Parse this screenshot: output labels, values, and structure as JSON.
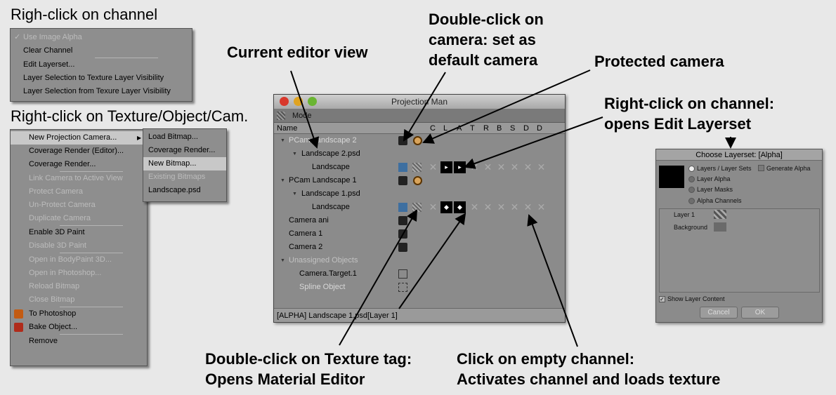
{
  "captions": {
    "right_click_channel": "Righ-click on channel",
    "right_click_texture": "Right-click on Texture/Object/Cam."
  },
  "callouts": {
    "current_editor_view": "Current editor view",
    "double_click_camera": [
      "Double-click on",
      "camera: set as",
      "default camera"
    ],
    "protected_camera": "Protected camera",
    "right_click_edit_layerset": [
      "Right-click on channel:",
      "opens Edit Layerset"
    ],
    "double_click_texture": [
      "Double-click on Texture tag:",
      "Opens Material Editor"
    ],
    "click_empty_channel": [
      "Click on empty channel:",
      "Activates channel and loads texture"
    ]
  },
  "channel_menu": {
    "items": [
      {
        "label": "Use Image Alpha",
        "disabled": true,
        "checked": true
      },
      {
        "label": "Clear Channel",
        "disabled": false
      },
      {
        "label": "Edit Layerset...",
        "disabled": false
      },
      {
        "label": "Layer Selection to Texture Layer Visibility",
        "disabled": false
      },
      {
        "label": "Layer Selection from Texure Layer Visibility",
        "disabled": false
      }
    ]
  },
  "object_menu": {
    "items": [
      {
        "label": "New Projection Camera...",
        "disabled": false
      },
      {
        "label": "Coverage Render (Editor)...",
        "disabled": false
      },
      {
        "label": "Coverage Render...",
        "disabled": false
      },
      {
        "label": "Link Camera to Active View",
        "disabled": true
      },
      {
        "label": "Protect Camera",
        "disabled": true
      },
      {
        "label": "Un-Protect Camera",
        "disabled": true
      },
      {
        "label": "Duplicate Camera",
        "disabled": true
      },
      {
        "label": "Enable 3D Paint",
        "disabled": false
      },
      {
        "label": "Disable 3D Paint",
        "disabled": true
      },
      {
        "label": "Open in BodyPaint 3D...",
        "disabled": true
      },
      {
        "label": "Open in Photoshop...",
        "disabled": true
      },
      {
        "label": "Reload Bitmap",
        "disabled": true
      },
      {
        "label": "Close Bitmap",
        "disabled": true
      },
      {
        "label": "To Photoshop",
        "disabled": false,
        "icon": "photoshop-icon"
      },
      {
        "label": "Bake Object...",
        "disabled": false,
        "icon": "bake-icon"
      },
      {
        "label": "Remove",
        "disabled": false
      }
    ],
    "submenu": [
      {
        "label": "Load Bitmap...",
        "disabled": false
      },
      {
        "label": "Coverage Render...",
        "disabled": false
      },
      {
        "label": "New Bitmap...",
        "disabled": false,
        "highlighted": true
      },
      {
        "label": "Existing Bitmaps",
        "disabled": true
      },
      {
        "label": "Landscape.psd",
        "disabled": false
      }
    ]
  },
  "projection_man": {
    "title": "Projection Man",
    "mode_label": "Mode",
    "name_header": "Name",
    "channel_headers": [
      "C",
      "L",
      "A",
      "T",
      "R",
      "B",
      "S",
      "D",
      "D"
    ],
    "rows": [
      {
        "label": "PCam Landscape 2",
        "indent": 0,
        "expanded": true,
        "style": "active"
      },
      {
        "label": "Landscape 2.psd",
        "indent": 1,
        "expanded": true
      },
      {
        "label": "Landscape",
        "indent": 2
      },
      {
        "label": "PCam Landscape 1",
        "indent": 0,
        "expanded": true
      },
      {
        "label": "Landscape 1.psd",
        "indent": 1,
        "expanded": true
      },
      {
        "label": "Landscape",
        "indent": 2
      },
      {
        "label": "Camera ani",
        "indent": 0
      },
      {
        "label": "Camera 1",
        "indent": 0
      },
      {
        "label": "Camera 2",
        "indent": 0
      },
      {
        "label": "Unassigned Objects",
        "indent": 0,
        "expanded": true,
        "style": "dim"
      },
      {
        "label": "Camera.Target.1",
        "indent": 1
      },
      {
        "label": "Spline Object",
        "indent": 1,
        "style": "active"
      }
    ],
    "status": "[ALPHA] Landscape 1.psd[Layer 1]"
  },
  "layerset_dialog": {
    "title": "Choose Layerset:  [Alpha]",
    "options": [
      {
        "label": "Layers / Layer Sets",
        "selected": true
      },
      {
        "label": "Layer Alpha",
        "selected": false
      },
      {
        "label": "Layer Masks",
        "selected": false
      },
      {
        "label": "Alpha Channels",
        "selected": false
      }
    ],
    "generate_alpha_label": "Generate Alpha",
    "layers": [
      "Layer 1",
      "Background"
    ],
    "show_layer_content_label": "Show Layer Content",
    "cancel_label": "Cancel",
    "ok_label": "OK"
  }
}
